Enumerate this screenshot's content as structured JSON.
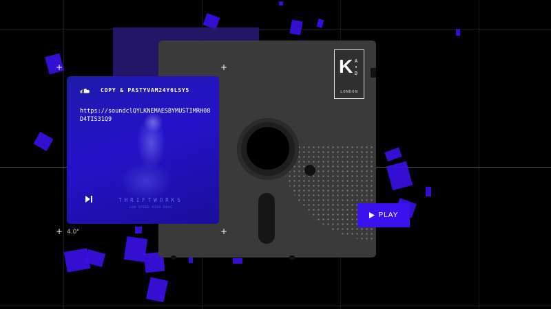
{
  "brand": {
    "monogram": "K",
    "monogram_small": "A\n•\nD",
    "city": "LONDON"
  },
  "track": {
    "copy_label": "COPY & PASTYVAM24Y6LSY5",
    "url": "https://soundclQYLKNEMAESBYMUSTIMRH08D4TIS31Q9",
    "artist": "THRIFTWORKS",
    "subtitle": "LOW SPEED HIGH DRAG"
  },
  "play_button": {
    "label": "PLAY",
    "icon": "play-icon"
  },
  "disk_size": "4.0\"",
  "crosshair_glyph": "+",
  "colors": {
    "accent": "#3a12f0",
    "card": "#2412c8",
    "floppy": "#3a3a3a"
  }
}
